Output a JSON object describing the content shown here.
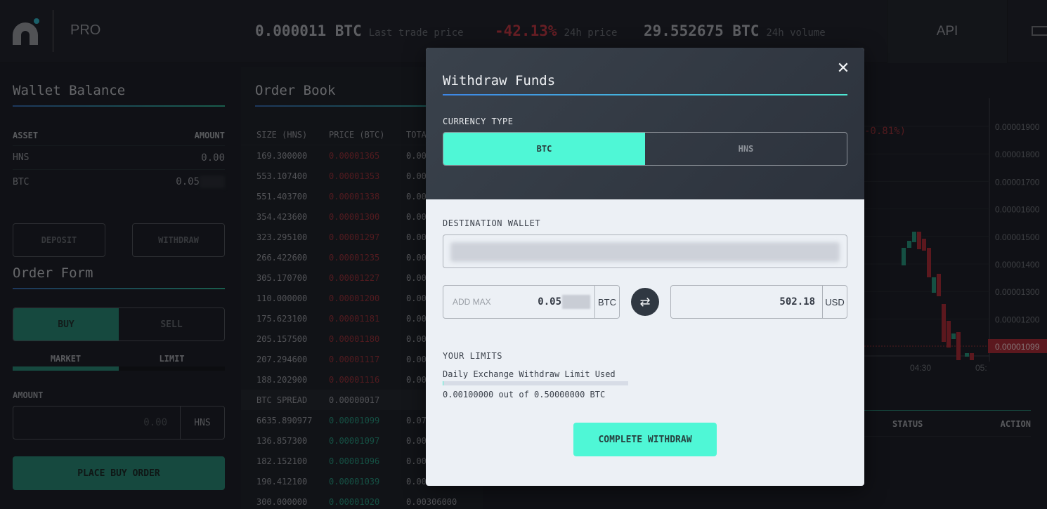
{
  "header": {
    "brand": "PRO",
    "last_trade_value": "0.000011 BTC",
    "last_trade_label": "Last trade price",
    "price_change_value": "-42.13%",
    "price_change_label": "24h price",
    "volume_value": "29.552675 BTC",
    "volume_label": "24h volume",
    "api_label": "API",
    "icons": {
      "logo": "logo-icon",
      "wallet": "cash-icon"
    }
  },
  "wallet_balance": {
    "title": "Wallet Balance",
    "columns": [
      "ASSET",
      "AMOUNT"
    ],
    "rows": [
      {
        "asset": "HNS",
        "amount": "0.00"
      },
      {
        "asset": "BTC",
        "amount": "0.05"
      }
    ],
    "deposit_label": "DEPOSIT",
    "withdraw_label": "WITHDRAW"
  },
  "order_form": {
    "title": "Order Form",
    "side_options": [
      "BUY",
      "SELL"
    ],
    "selected_side": "BUY",
    "type_options": [
      "MARKET",
      "LIMIT"
    ],
    "selected_type": "MARKET",
    "amount_label": "AMOUNT",
    "amount_placeholder": "0.00",
    "amount_unit": "HNS",
    "submit_label": "PLACE BUY ORDER"
  },
  "order_book": {
    "title": "Order Book",
    "columns": [
      "SIZE (HNS)",
      "PRICE (BTC)",
      "TOTA"
    ],
    "asks": [
      {
        "size": "169.300000",
        "price": "0.00001365",
        "total": "0.00"
      },
      {
        "size": "553.107400",
        "price": "0.00001353",
        "total": "0.00"
      },
      {
        "size": "551.403700",
        "price": "0.00001338",
        "total": "0.00"
      },
      {
        "size": "354.423600",
        "price": "0.00001300",
        "total": "0.00"
      },
      {
        "size": "323.295100",
        "price": "0.00001297",
        "total": "0.00"
      },
      {
        "size": "266.422600",
        "price": "0.00001235",
        "total": "0.00"
      },
      {
        "size": "305.170700",
        "price": "0.00001227",
        "total": "0.00"
      },
      {
        "size": "110.000000",
        "price": "0.00001200",
        "total": "0.00"
      },
      {
        "size": "175.623100",
        "price": "0.00001181",
        "total": "0.00"
      },
      {
        "size": "205.157500",
        "price": "0.00001180",
        "total": "0.00"
      },
      {
        "size": "207.294600",
        "price": "0.00001117",
        "total": "0.00"
      },
      {
        "size": "188.202900",
        "price": "0.00001116",
        "total": "0.00"
      }
    ],
    "spread": {
      "label": "BTC SPREAD",
      "value": "0.00000017"
    },
    "bids": [
      {
        "size": "6635.890977",
        "price": "0.00001099",
        "total": "0.07"
      },
      {
        "size": "136.857300",
        "price": "0.00001097",
        "total": "0.00"
      },
      {
        "size": "182.152100",
        "price": "0.00001096",
        "total": "0.00"
      },
      {
        "size": "190.412100",
        "price": "0.00001039",
        "total": "0.00"
      },
      {
        "size": "300.000000",
        "price": "0.00001020",
        "total": "0.00306000"
      }
    ]
  },
  "chart": {
    "change_text": "-0.81%)",
    "y_ticks": [
      "0.00001900",
      "0.00001800",
      "0.00001700",
      "0.00001600",
      "0.00001500",
      "0.00001400",
      "0.00001300",
      "0.00001200"
    ],
    "current_price_tag": "0.00001099",
    "x_ticks": [
      "04:30",
      "05:"
    ]
  },
  "trades_table": {
    "columns": [
      "STATUS",
      "ACTION"
    ]
  },
  "modal": {
    "title": "Withdraw Funds",
    "close_icon": "close-icon",
    "currency_type_label": "CURRENCY TYPE",
    "currency_options": [
      "BTC",
      "HNS"
    ],
    "selected_currency": "BTC",
    "destination_label": "DESTINATION WALLET",
    "destination_value": "",
    "add_max_label": "ADD MAX",
    "crypto_amount": "0.05",
    "crypto_unit": "BTC",
    "swap_icon": "swap-icon",
    "usd_amount": "502.18",
    "usd_unit": "USD",
    "limits_label": "YOUR LIMITS",
    "limit_name": "Daily Exchange Withdraw Limit Used",
    "limit_used_fraction": 0.002,
    "limit_text": "0.00100000 out of 0.50000000 BTC",
    "submit_label": "COMPLETE WITHDRAW",
    "colors": {
      "accent": "#4ff7d6",
      "header_bg": "#343b45",
      "body_bg": "#ecf0f5"
    }
  }
}
